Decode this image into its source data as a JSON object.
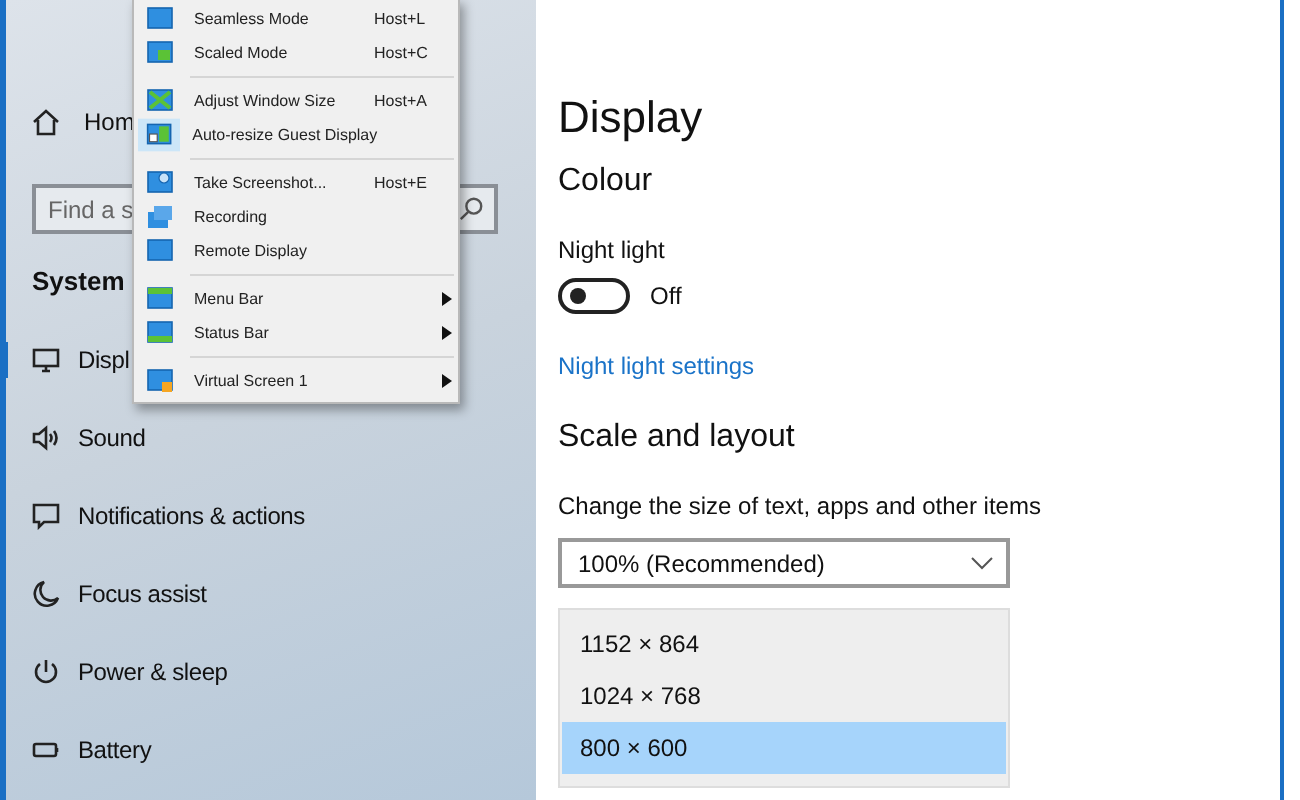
{
  "sidebar": {
    "home": "Hom",
    "search": {
      "placeholder": "Find a s"
    },
    "section": "System",
    "items": [
      {
        "label": "Displ",
        "selected": true
      },
      {
        "label": "Sound",
        "selected": false
      },
      {
        "label": "Notifications & actions",
        "selected": false
      },
      {
        "label": "Focus assist",
        "selected": false
      },
      {
        "label": "Power & sleep",
        "selected": false
      },
      {
        "label": "Battery",
        "selected": false
      }
    ]
  },
  "context_menu": {
    "groups": [
      [
        {
          "label": "Seamless Mode",
          "shortcut": "Host+L",
          "checked": false,
          "submenu": false
        },
        {
          "label": "Scaled Mode",
          "shortcut": "Host+C",
          "checked": false,
          "submenu": false
        }
      ],
      [
        {
          "label": "Adjust Window Size",
          "shortcut": "Host+A",
          "checked": false,
          "submenu": false
        },
        {
          "label": "Auto-resize Guest Display",
          "checked": true,
          "submenu": false
        }
      ],
      [
        {
          "label": "Take Screenshot...",
          "shortcut": "Host+E",
          "checked": false,
          "submenu": false
        },
        {
          "label": "Recording",
          "checked": false,
          "submenu": false
        },
        {
          "label": "Remote Display",
          "checked": false,
          "submenu": false
        }
      ],
      [
        {
          "label": "Menu Bar",
          "checked": false,
          "submenu": true
        },
        {
          "label": "Status Bar",
          "checked": false,
          "submenu": true
        }
      ],
      [
        {
          "label": "Virtual Screen 1",
          "checked": false,
          "submenu": true
        }
      ]
    ]
  },
  "content": {
    "title": "Display",
    "colour_heading": "Colour",
    "night_light": {
      "label": "Night light",
      "on": false,
      "state": "Off"
    },
    "link": "Night light settings",
    "scale_heading": "Scale and layout",
    "scale_label": "Change the size of text, apps and other items",
    "scale_dropdown": {
      "value": "100% (Recommended)"
    },
    "resolution_list": [
      {
        "label": "1152 × 864",
        "selected": false
      },
      {
        "label": "1024 × 768",
        "selected": false
      },
      {
        "label": "800 × 600",
        "selected": true
      }
    ]
  }
}
